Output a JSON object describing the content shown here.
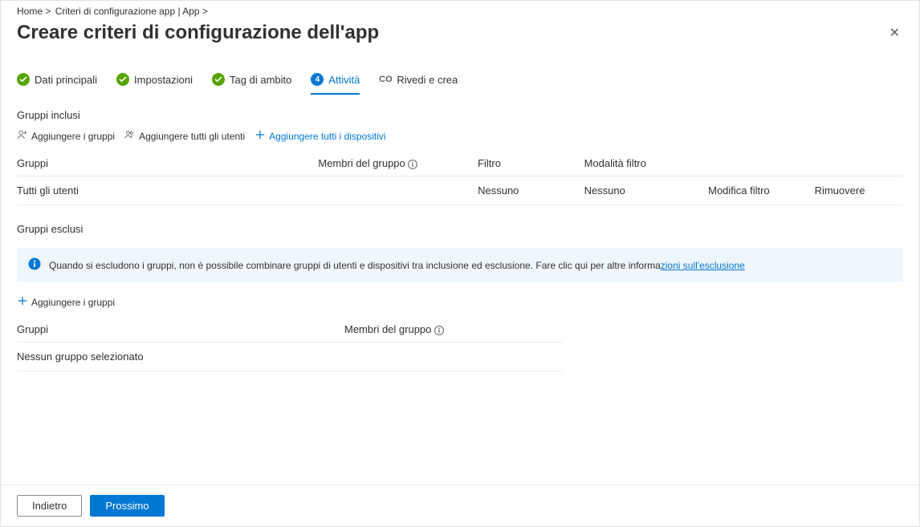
{
  "breadcrumb": {
    "home": "Home >",
    "policies": "Criteri di configurazione app | App >"
  },
  "page_title": "Creare criteri di configurazione dell'app",
  "steps": {
    "basics": "Dati principali",
    "settings": "Impostazioni",
    "scope_tags": "Tag di ambito",
    "assignments_num": "4",
    "assignments": "Attività",
    "review_prefix": "CO",
    "review": "Rivedi e crea"
  },
  "included": {
    "title": "Gruppi inclusi",
    "add_groups": "Aggiungere i gruppi",
    "add_all_users": "Aggiungere tutti gli utenti",
    "add_all_devices": "Aggiungere tutti i dispositivi",
    "table": {
      "headers": {
        "groups": "Gruppi",
        "group_members": "Membri del gruppo",
        "filter": "Filtro",
        "filter_mode": "Modalità filtro"
      },
      "row": {
        "groups": "Tutti gli utenti",
        "group_members": "",
        "filter": "Nessuno",
        "filter_mode": "Nessuno",
        "edit_filter": "Modifica filtro",
        "remove": "Rimuovere"
      }
    }
  },
  "excluded": {
    "title": "Gruppi esclusi",
    "info": "Quando si escludono i gruppi, non è possibile combinare gruppi di utenti e dispositivi tra inclusione ed esclusione. Fare clic qui per altre informa",
    "info_link": "zioni sull'esclusione",
    "add_groups": "Aggiungere i gruppi",
    "table": {
      "headers": {
        "groups": "Gruppi",
        "group_members": "Membri del gruppo"
      },
      "empty": "Nessun gruppo selezionato"
    }
  },
  "footer": {
    "back": "Indietro",
    "next": "Prossimo"
  }
}
